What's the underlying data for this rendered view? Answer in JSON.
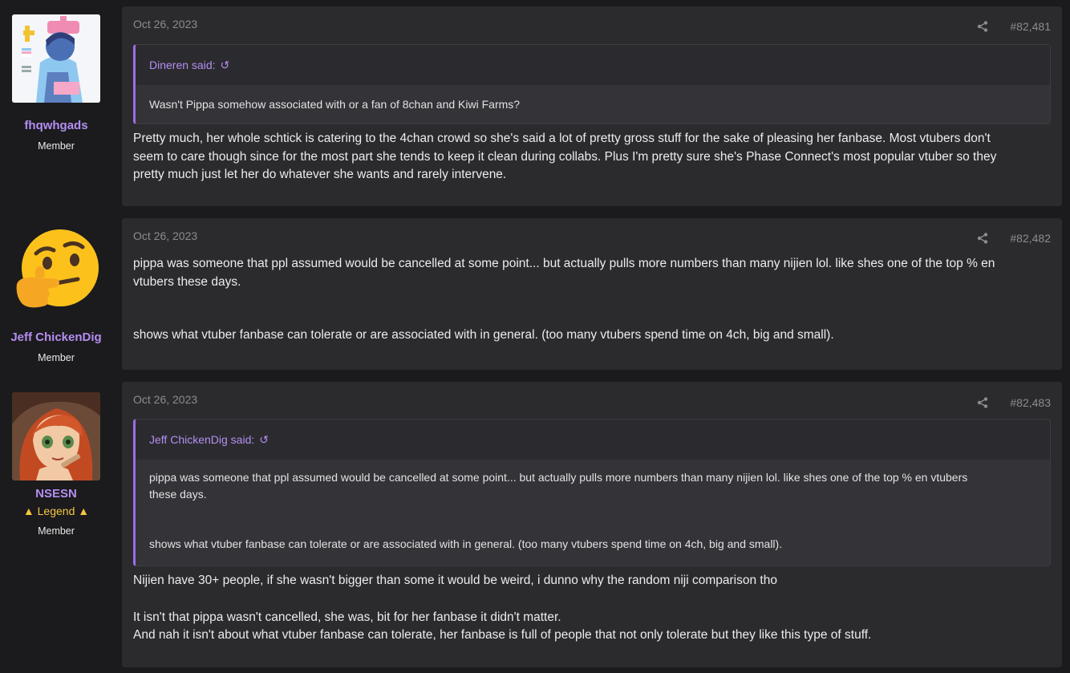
{
  "posts": [
    {
      "user": {
        "name": "fhqwhgads",
        "role": "Member",
        "avatar": "pink-nurse-character-avatar"
      },
      "date": "Oct 26, 2023",
      "number": "#82,481",
      "quote": {
        "author": "Dineren said:",
        "lines": [
          "Wasn't Pippa somehow associated with or a fan of 8chan and Kiwi Farms?"
        ]
      },
      "lines": [
        "Pretty much, her whole schtick is catering to the 4chan crowd so she's said a lot of pretty gross stuff for the sake of pleasing her fanbase. Most vtubers don't",
        "seem to care though since for the most part she tends to keep it clean during collabs. Plus I'm pretty sure she's Phase Connect's most popular vtuber so they",
        "pretty much just let her do whatever she wants and rarely intervene."
      ]
    },
    {
      "user": {
        "name": "Jeff ChickenDig",
        "role": "Member",
        "avatar": "thinking-face-emoji-avatar"
      },
      "date": "Oct 26, 2023",
      "number": "#82,482",
      "lines": [
        "pippa was someone that ppl assumed would be cancelled at some point... but actually pulls more numbers than many nijien lol. like shes one of the top % en",
        "vtubers these days.",
        "shows what vtuber fanbase can tolerate or are associated with in general. (too many vtubers spend time on 4ch, big and small)."
      ]
    },
    {
      "user": {
        "name": "NSESN",
        "banner": "▲ Legend ▲",
        "role": "Member",
        "avatar": "red-haired-girl-avatar"
      },
      "date": "Oct 26, 2023",
      "number": "#82,483",
      "quote": {
        "author": "Jeff ChickenDig said:",
        "lines": [
          "pippa was someone that ppl assumed would be cancelled at some point... but actually pulls more numbers than many nijien lol. like shes one of the top % en vtubers",
          "these days.",
          "shows what vtuber fanbase can tolerate or are associated with in general. (too many vtubers spend time on 4ch, big and small)."
        ]
      },
      "lines": [
        "Nijien have 30+ people, if she wasn't bigger than some it would be weird, i dunno why the random niji comparison tho",
        "It isn't that pippa wasn't cancelled, she was, bit for her fanbase it didn't matter.",
        "And nah it isn't about what vtuber fanbase can tolerate, her fanbase is full of people that not only tolerate but they like this type of stuff."
      ]
    }
  ],
  "icons": {
    "share": "share-icon",
    "reply_arrow": "reply-arrow-icon"
  },
  "colors": {
    "accent": "#b48ef2",
    "quote_border": "#9b6ee6",
    "legend": "#f5c542",
    "post_bg": "#2b2b2e",
    "page_bg": "#1b1b1d"
  }
}
